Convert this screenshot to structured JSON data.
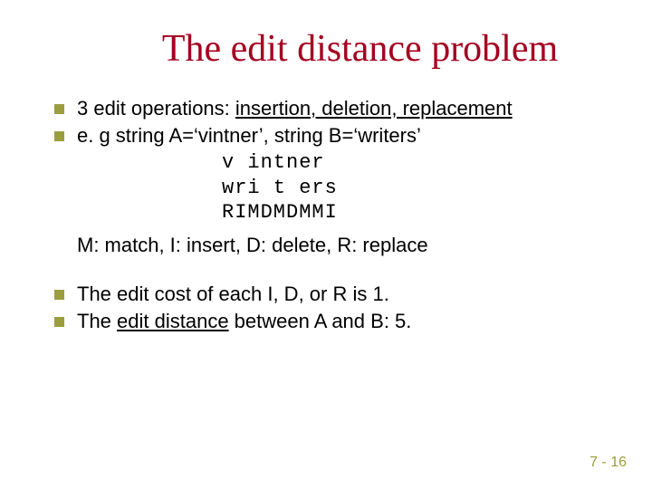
{
  "title": "The edit distance problem",
  "b1_lead": "3 edit operations: ",
  "b1_ops": "insertion, deletion, replacement",
  "b2_pre": "e. g string A=",
  "b2_q1": "‘",
  "b2_a": "vintner",
  "b2_q2": "’",
  "b2_mid": ", string B=",
  "b2_q3": "‘",
  "b2_b": "writers",
  "b2_q4": "’",
  "mono1": "v intner",
  "mono2": "wri t ers",
  "mono3": "RIMDMDMMI",
  "legend": "M: match, I: insert, D: delete, R: replace",
  "b3": "The edit cost of each I, D, or R is 1.",
  "b4_pre": "The ",
  "b4_u": "edit distance",
  "b4_post": " between A and B: 5.",
  "pagenum": "7 - 16"
}
